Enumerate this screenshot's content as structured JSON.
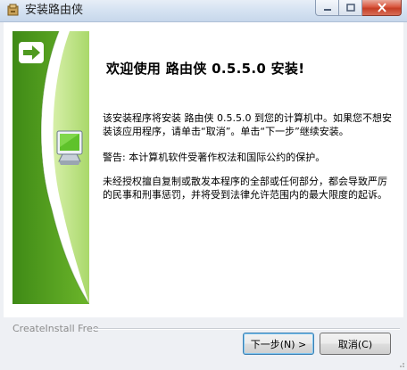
{
  "window": {
    "title": "安装路由侠",
    "icon": "installer-icon",
    "caption_buttons": [
      "minimize-icon",
      "maximize-icon",
      "close-icon"
    ]
  },
  "main": {
    "heading": "欢迎使用 路由侠 0.5.5.0 安装!",
    "paragraphs": [
      "该安装程序将安装 路由侠 0.5.5.0 到您的计算机中。如果您不想安装该应用程序，请单击“取消”。单击“下一步”继续安装。",
      "警告: 本计算机软件受著作权法和国际公约的保护。",
      "未经授权擅自复制或散发本程序的全部或任何部分，都会导致严厉的民事和刑事惩罚，并将受到法律允许范围内的最大限度的起诉。"
    ],
    "banner": {
      "arrow_icon": "arrow-right-icon",
      "monitor_icon": "computer-monitor-icon",
      "accent_green": "#4f9a1f",
      "light_green": "#b8e07a"
    }
  },
  "footer": {
    "brand": "CreateInstall Free",
    "next_label": "下一步(N) >",
    "cancel_label": "取消(C)"
  }
}
